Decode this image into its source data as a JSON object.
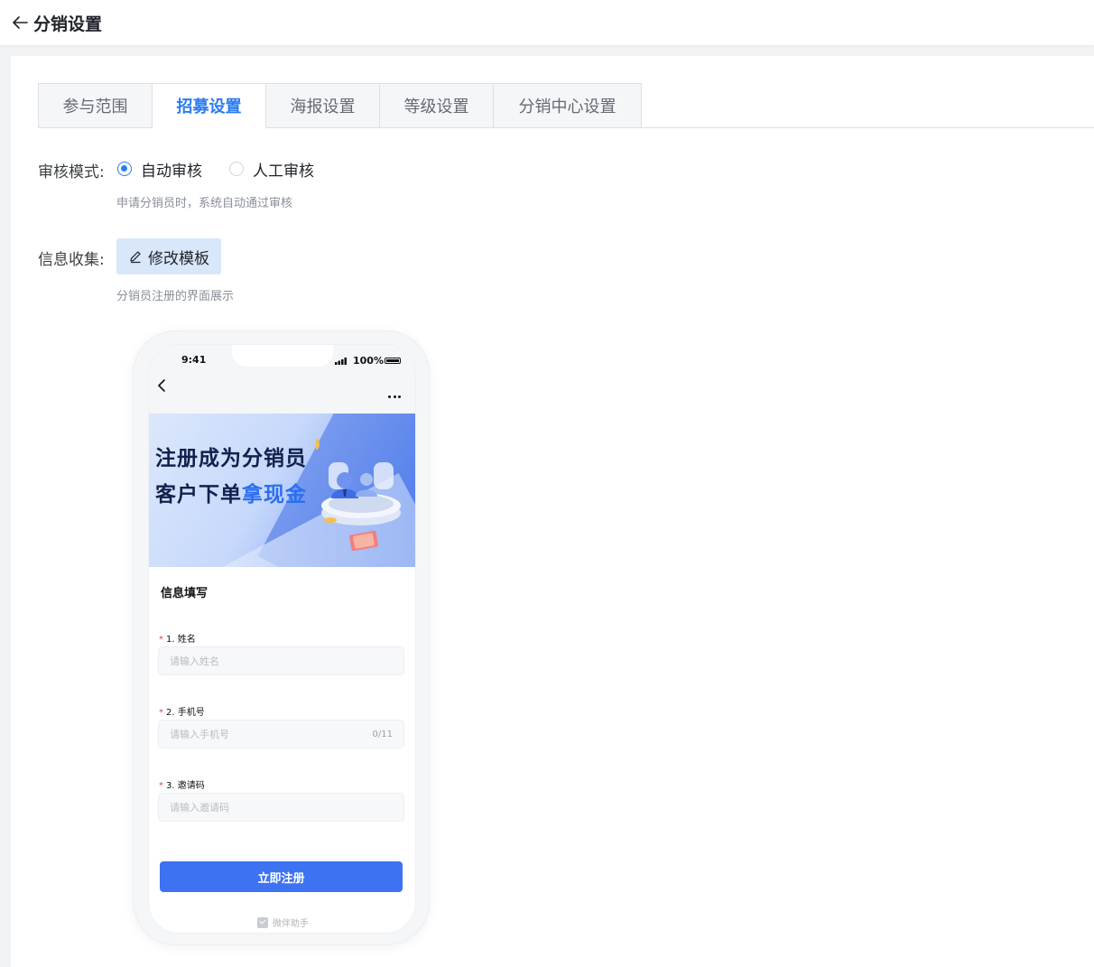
{
  "header": {
    "title": "分销设置"
  },
  "tabs": [
    {
      "label": "参与范围",
      "active": false
    },
    {
      "label": "招募设置",
      "active": true
    },
    {
      "label": "海报设置",
      "active": false
    },
    {
      "label": "等级设置",
      "active": false
    },
    {
      "label": "分销中心设置",
      "active": false
    }
  ],
  "review": {
    "label": "审核模式:",
    "options": [
      {
        "label": "自动审核",
        "checked": true
      },
      {
        "label": "人工审核",
        "checked": false
      }
    ],
    "hint": "申请分销员时，系统自动通过审核"
  },
  "info": {
    "label": "信息收集:",
    "button": "修改模板",
    "hint": "分销员注册的界面展示"
  },
  "phone": {
    "time": "9:41",
    "battery": "100%",
    "banner": {
      "line1": "注册成为分销员",
      "line2_a": "客户下单",
      "line2_b": "拿现金"
    },
    "form_title": "信息填写",
    "fields": [
      {
        "label": "1. 姓名",
        "placeholder": "请输入姓名",
        "count": ""
      },
      {
        "label": "2. 手机号",
        "placeholder": "请输入手机号",
        "count": "0/11"
      },
      {
        "label": "3. 邀请码",
        "placeholder": "请输入邀请码",
        "count": ""
      }
    ],
    "submit": "立即注册",
    "footer": "微伴助手"
  },
  "colors": {
    "accent": "#2a7cf5",
    "button": "#3d72f3",
    "edit_bg": "#d9e7fb"
  }
}
